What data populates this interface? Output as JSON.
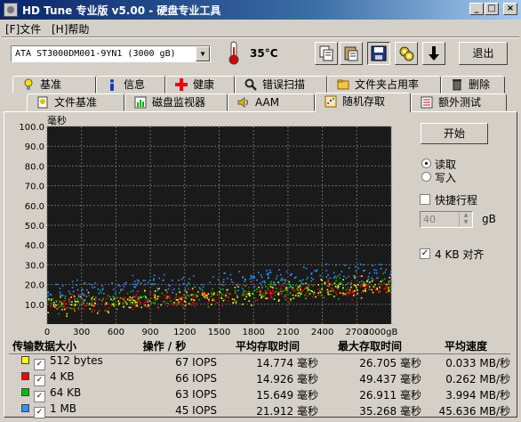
{
  "window": {
    "title": "HD Tune 专业版 v5.00 - 硬盘专业工具"
  },
  "menu": [
    "[F]文件",
    "[H]帮助"
  ],
  "toolbar": {
    "drive": "ATA    ST3000DM001-9YN1 (3000 gB)",
    "temperature": "35°C",
    "exit_label": "退出",
    "icons": [
      "copy-icon",
      "paste-icon",
      "save-icon",
      "options-icon",
      "down-arrow-icon"
    ]
  },
  "tabs_row1": [
    {
      "label": "基准",
      "icon": "lightbulb-icon"
    },
    {
      "label": "信息",
      "icon": "info-icon"
    },
    {
      "label": "健康",
      "icon": "plus-icon"
    },
    {
      "label": "错误扫描",
      "icon": "magnifier-icon"
    },
    {
      "label": "文件夹占用率",
      "icon": "folder-icon"
    },
    {
      "label": "删除",
      "icon": "trash-icon"
    }
  ],
  "tabs_row2": [
    {
      "label": "文件基准",
      "icon": "file-bench-icon"
    },
    {
      "label": "磁盘监视器",
      "icon": "monitor-icon"
    },
    {
      "label": "AAM",
      "icon": "speaker-icon"
    },
    {
      "label": "随机存取",
      "icon": "random-access-icon",
      "active": true
    },
    {
      "label": "额外测试",
      "icon": "extra-tests-icon"
    }
  ],
  "sidebar": {
    "start_label": "开始",
    "read_label": "读取",
    "write_label": "写入",
    "mode": "read",
    "quick_label": "快捷行程",
    "quick_checked": false,
    "quick_value": "40",
    "quick_unit": "gB",
    "align_label": "4 KB 对齐",
    "align_checked": true
  },
  "chart_data": {
    "type": "scatter",
    "ylabel": "毫秒",
    "xlabel": "gB",
    "xlim": [
      0,
      3000
    ],
    "ylim": [
      0,
      100
    ],
    "x_ticks": [
      "0",
      "300",
      "600",
      "900",
      "1200",
      "1500",
      "1800",
      "2100",
      "2400",
      "2700",
      "3000gB"
    ],
    "y_ticks": [
      "100.0",
      "90.0",
      "80.0",
      "70.0",
      "60.0",
      "50.0",
      "40.0",
      "30.0",
      "20.0",
      "10.0"
    ],
    "grid": true,
    "background": "#1a1a1a",
    "series": [
      {
        "name": "512 bytes",
        "color": "#ffff00",
        "trend": [
          [
            0,
            9.5
          ],
          [
            1500,
            14.8
          ],
          [
            3000,
            19.5
          ]
        ]
      },
      {
        "name": "4 KB",
        "color": "#ff0000",
        "trend": [
          [
            0,
            9.8
          ],
          [
            1500,
            14.9
          ],
          [
            3000,
            19.8
          ]
        ]
      },
      {
        "name": "64 KB",
        "color": "#00c000",
        "trend": [
          [
            0,
            10.5
          ],
          [
            1500,
            15.6
          ],
          [
            3000,
            20.5
          ]
        ]
      },
      {
        "name": "1 MB",
        "color": "#3090ff",
        "trend": [
          [
            0,
            16.5
          ],
          [
            1500,
            22.0
          ],
          [
            3000,
            27.0
          ]
        ]
      }
    ]
  },
  "results": {
    "headers": [
      "传输数据大小",
      "操作 / 秒",
      "平均存取时间",
      "最大存取时间",
      "平均速度"
    ],
    "rows": [
      {
        "color": "#ffff00",
        "size": "512 bytes",
        "ops": "67 IOPS",
        "avg": "14.774 毫秒",
        "max": "26.705 毫秒",
        "speed": "0.033 MB/秒"
      },
      {
        "color": "#ff0000",
        "size": "4 KB",
        "ops": "66 IOPS",
        "avg": "14.926 毫秒",
        "max": "49.437 毫秒",
        "speed": "0.262 MB/秒"
      },
      {
        "color": "#00c000",
        "size": "64 KB",
        "ops": "63 IOPS",
        "avg": "15.649 毫秒",
        "max": "26.911 毫秒",
        "speed": "3.994 MB/秒"
      },
      {
        "color": "#3090ff",
        "size": "1 MB",
        "ops": "45 IOPS",
        "avg": "21.912 毫秒",
        "max": "35.268 毫秒",
        "speed": "45.636 MB/秒"
      }
    ]
  }
}
